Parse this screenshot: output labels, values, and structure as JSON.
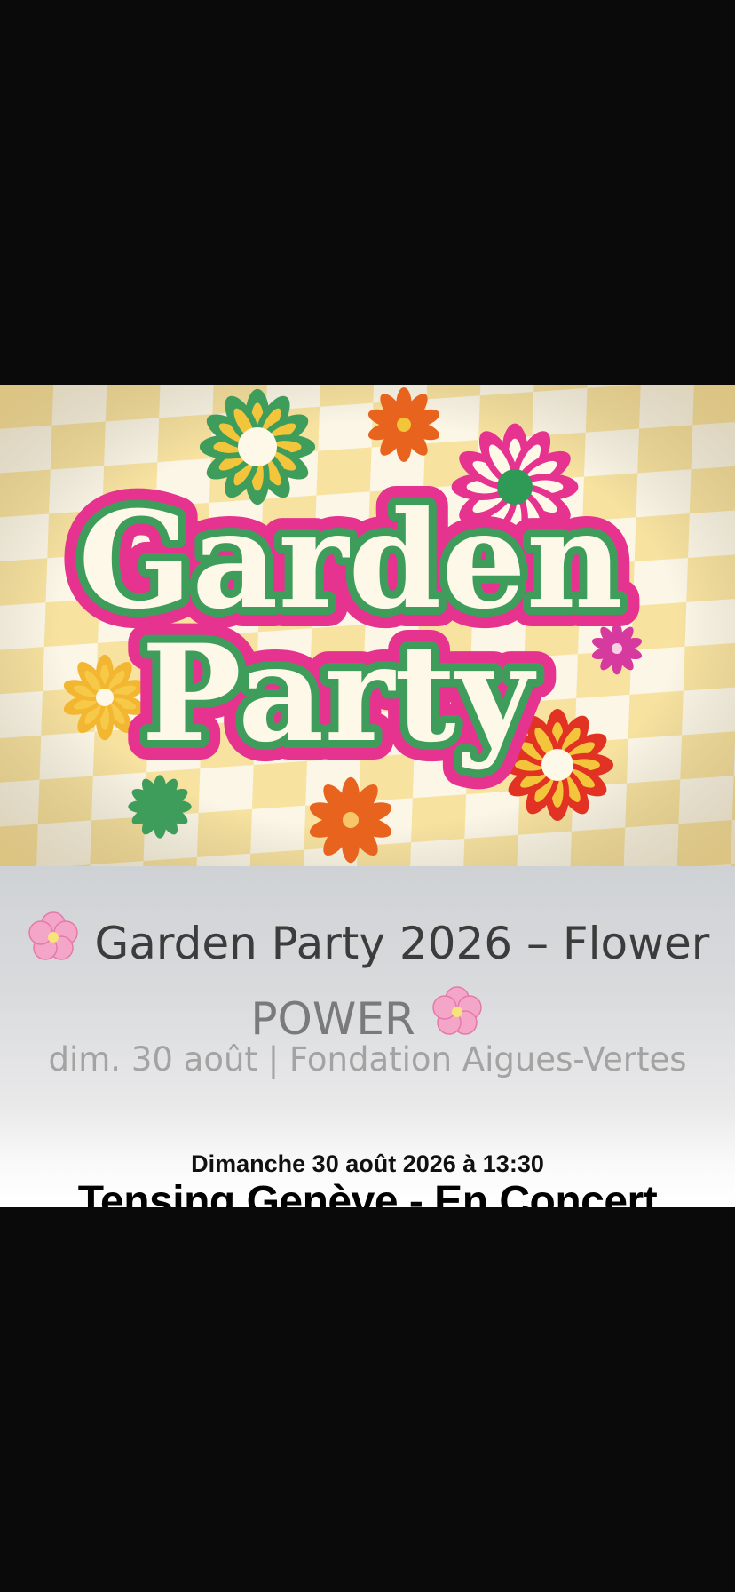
{
  "art": {
    "logo_line1": "Garden",
    "logo_line2": "Party",
    "colors": {
      "checker_yellow": "#f7e2a0",
      "checker_light": "#fbf6e6",
      "logo_pink": "#e5338f",
      "logo_green": "#3f9d5c",
      "logo_cream": "#fdf8e8"
    }
  },
  "event": {
    "title_line1": "Garden Party 2026 – Flower",
    "title_line2": "POWER",
    "meta": "dim. 30 août  |  Fondation Aigues-Vertes",
    "blossom_icon": "cherry-blossom-icon"
  },
  "caption": {
    "date": "Dimanche 30 août 2026 à 13:30",
    "headline": "Tensing Genève - En Concert"
  }
}
